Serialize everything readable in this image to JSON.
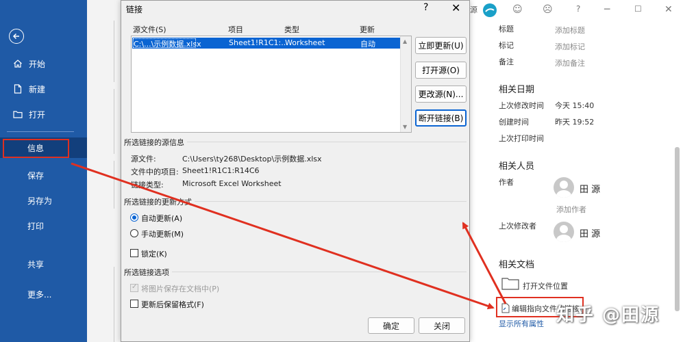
{
  "sidebar": {
    "back_icon": "back-arrow-icon",
    "items": [
      {
        "label": "开始",
        "icon": "home-icon"
      },
      {
        "label": "新建",
        "icon": "new-document-icon"
      },
      {
        "label": "打开",
        "icon": "folder-open-icon"
      },
      {
        "label": "信息",
        "icon": ""
      },
      {
        "label": "保存",
        "icon": ""
      },
      {
        "label": "另存为",
        "icon": ""
      },
      {
        "label": "打印",
        "icon": ""
      },
      {
        "label": "共享",
        "icon": ""
      },
      {
        "label": "更多...",
        "icon": ""
      }
    ],
    "bg_color": "#1f5aa6",
    "selected_color": "#123f7c"
  },
  "topbar": {
    "fragment": "源"
  },
  "info_pane": {
    "properties": [
      {
        "label": "标题",
        "value": "添加标题"
      },
      {
        "label": "标记",
        "value": "添加标记"
      },
      {
        "label": "备注",
        "value": "添加备注"
      }
    ],
    "dates_heading": "相关日期",
    "dates": [
      {
        "label": "上次修改时间",
        "value": "今天 15:40"
      },
      {
        "label": "创建时间",
        "value": "昨天 19:52"
      },
      {
        "label": "上次打印时间",
        "value": ""
      }
    ],
    "people_heading": "相关人员",
    "author_label": "作者",
    "author_name": "田 源",
    "add_author": "添加作者",
    "last_modified_by_label": "上次修改者",
    "last_modified_by_name": "田 源",
    "docs_heading": "相关文档",
    "open_location": "打开文件位置",
    "edit_links": "编辑指向文件的链接",
    "show_all": "显示所有属性"
  },
  "watermark": "知乎 @田源",
  "dialog": {
    "title": "链接",
    "help": "?",
    "close": "✕",
    "columns": [
      "源文件(S)",
      "项目",
      "类型",
      "更新"
    ],
    "rows": [
      {
        "source": "C:\\...\\示例数据.xlsx",
        "item": "Sheet1!R1C1:...",
        "type": "Worksheet",
        "update": "自动"
      }
    ],
    "buttons": {
      "update_now": "立即更新(U)",
      "open_source": "打开源(O)",
      "change_source": "更改源(N)...",
      "break_link": "断开链接(B)"
    },
    "source_info": {
      "heading": "所选链接的源信息",
      "source_file_label": "源文件:",
      "source_file": "C:\\Users\\ty268\\Desktop\\示例数据.xlsx",
      "item_label": "文件中的项目:",
      "item": "Sheet1!R1C1:R14C6",
      "link_type_label": "链接类型:",
      "link_type": "Microsoft Excel Worksheet"
    },
    "update_method": {
      "heading": "所选链接的更新方式",
      "auto": "自动更新(A)",
      "manual": "手动更新(M)",
      "locked": "锁定(K)",
      "selected": "auto"
    },
    "options": {
      "heading": "所选链接选项",
      "save_picture": "将图片保存在文档中(P)",
      "keep_format": "更新后保留格式(F)"
    },
    "ok": "确定",
    "cancel": "关闭"
  },
  "colors": {
    "accent": "#0a64d2",
    "annotation_red": "#e03020"
  }
}
